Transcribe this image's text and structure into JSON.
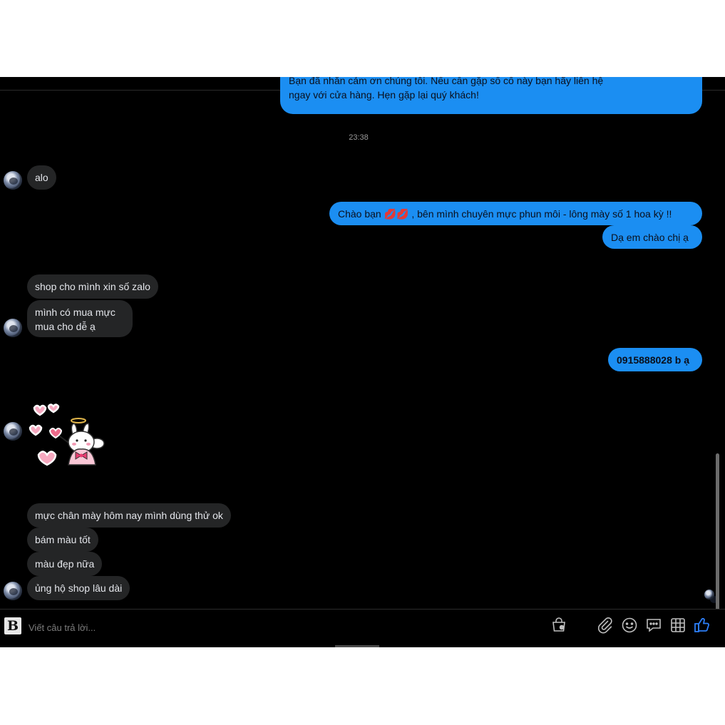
{
  "conversation": {
    "top_message": {
      "line1": "Bạn đã nhắn cảm ơn chúng tôi. Nếu cần gặp số cố này bạn hãy liên hệ",
      "line2": "ngay với cửa hàng. Hẹn gặp lại quý khách!"
    },
    "timestamp": "23:38",
    "messages": [
      {
        "sender": "customer",
        "text": "alo"
      },
      {
        "sender": "shop",
        "text": "Chào bạn 💋💋 , bên mình chuyên mực phun môi - lông mày số 1 hoa kỳ !!"
      },
      {
        "sender": "shop",
        "text": "Dạ em chào chị ạ"
      },
      {
        "sender": "customer",
        "text": "shop cho mình xin số zalo"
      },
      {
        "sender": "customer",
        "line1": "mình có mua mực",
        "line2": "mua cho dễ ạ"
      },
      {
        "sender": "shop",
        "text": "0915888028 b ạ"
      },
      {
        "sender": "customer",
        "sticker": "bunny-angel-hearts-sticker"
      },
      {
        "sender": "customer",
        "text": "mực chân mày hôm nay mình dùng thử ok"
      },
      {
        "sender": "customer",
        "text": "bám màu tốt"
      },
      {
        "sender": "customer",
        "text": "màu đẹp nữa"
      },
      {
        "sender": "customer",
        "text": "ủng hộ shop lâu dài"
      }
    ]
  },
  "composer": {
    "logo_letter": "B",
    "placeholder": "Viết câu trả lời...",
    "icons": [
      "shopping-bag-icon",
      "paperclip-icon",
      "emoji-icon",
      "saved-replies-icon",
      "table-grid-icon",
      "thumbs-up-icon"
    ]
  },
  "colors": {
    "background": "#000000",
    "incoming_bubble": "#242526",
    "outgoing_bubble": "#1b8ef2",
    "like_blue": "#2d7ff9"
  }
}
